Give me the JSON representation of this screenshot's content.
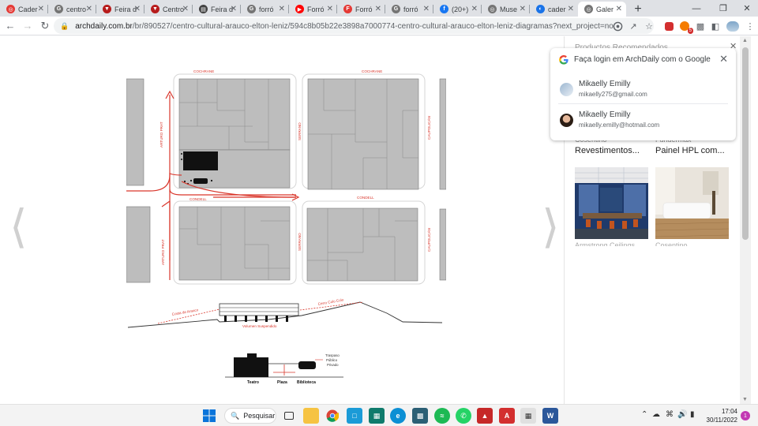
{
  "browser": {
    "tabs": [
      {
        "title": "Cader",
        "color": "#e53935",
        "glyph": "◎"
      },
      {
        "title": "centro",
        "color": "#757575",
        "glyph": "G"
      },
      {
        "title": "Feira d",
        "color": "#b71c1c",
        "glyph": "▼"
      },
      {
        "title": "Centro",
        "color": "#b71c1c",
        "glyph": "▼"
      },
      {
        "title": "Feira d",
        "color": "#424242",
        "glyph": "▤"
      },
      {
        "title": "forró",
        "color": "#757575",
        "glyph": "G"
      },
      {
        "title": "Forró",
        "color": "#ff0000",
        "glyph": "▶"
      },
      {
        "title": "Forró",
        "color": "#e53935",
        "glyph": "F"
      },
      {
        "title": "forró",
        "color": "#757575",
        "glyph": "G"
      },
      {
        "title": "(20+)",
        "color": "#1877f2",
        "glyph": "f"
      },
      {
        "title": "Muse",
        "color": "#757575",
        "glyph": "◎"
      },
      {
        "title": "cader",
        "color": "#1a73e8",
        "glyph": "◐"
      },
      {
        "title": "Galer",
        "color": "#757575",
        "glyph": "◎"
      }
    ],
    "active_tab": 12,
    "new_tab_glyph": "+",
    "url_domain": "archdaily.com.br",
    "url_path": "/br/890527/centro-cultural-arauco-elton-leniz/594c8b05b22e3898a7000774-centro-cultural-arauco-elton-leniz-diagramas?next_project=no",
    "extension_badge": "5"
  },
  "diagram": {
    "streets": {
      "cochrane": "COCHRANE",
      "condell": "CONDELL",
      "arturo_prat": "ARTURO PRAT",
      "serrano": "SERRANO",
      "caupolican": "CAUPOLICÁN"
    },
    "section_labels": {
      "costa": "Costa de Arauco",
      "cerro": "Cerro Colo Colo",
      "volumen": "Volumen Suspendido"
    },
    "program_labels": {
      "teatro": "Teatro",
      "plaza": "Plaza",
      "biblioteca": "Biblioteca",
      "traspaso_1": "Traspaso",
      "traspaso_2": "Público",
      "traspaso_3": "Privado"
    }
  },
  "behind_popup_text": "Productos Recomendados",
  "products": [
    {
      "brand": "Cosentino",
      "name": "Revestimentos...",
      "below": "Armstrong Ceilings"
    },
    {
      "brand": "Fundermax",
      "name": "Painel HPL com...",
      "below": "Cosentino"
    }
  ],
  "google_popup": {
    "title": "Faça login em ArchDaily com o Google",
    "accounts": [
      {
        "name": "Mikaelly Emilly",
        "email": "mikaelly275@gmail.com"
      },
      {
        "name": "Mikaelly Emilly",
        "email": "mikaelly.emilly@hotmail.com"
      }
    ]
  },
  "taskbar": {
    "search_label": "Pesquisar",
    "time": "17:04",
    "date": "30/11/2022",
    "notification_count": "1"
  },
  "colors": {
    "street_red": "#d9362b",
    "block_gray": "#bdbdbd",
    "accent": "#1a73e8"
  }
}
